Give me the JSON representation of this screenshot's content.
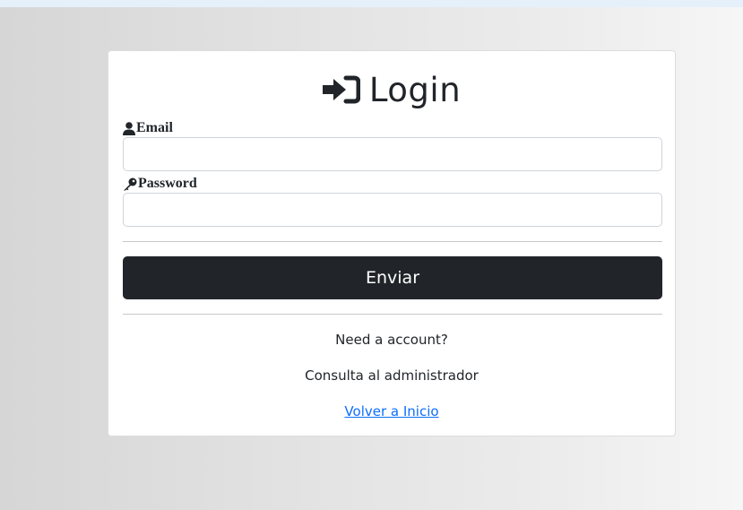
{
  "login": {
    "title": "Login",
    "title_icon": "sign-in-icon",
    "email_label": "Email",
    "email_icon": "user-icon",
    "email_value": "",
    "password_label": "Password",
    "password_icon": "key-icon",
    "password_value": "",
    "submit_label": "Enviar",
    "need_account_text": "Need a account?",
    "contact_admin_text": "Consulta al administrador",
    "back_link_text": "Volver a Inicio"
  },
  "colors": {
    "button_bg": "#212529",
    "link": "#0d6efd",
    "text": "#212529"
  }
}
